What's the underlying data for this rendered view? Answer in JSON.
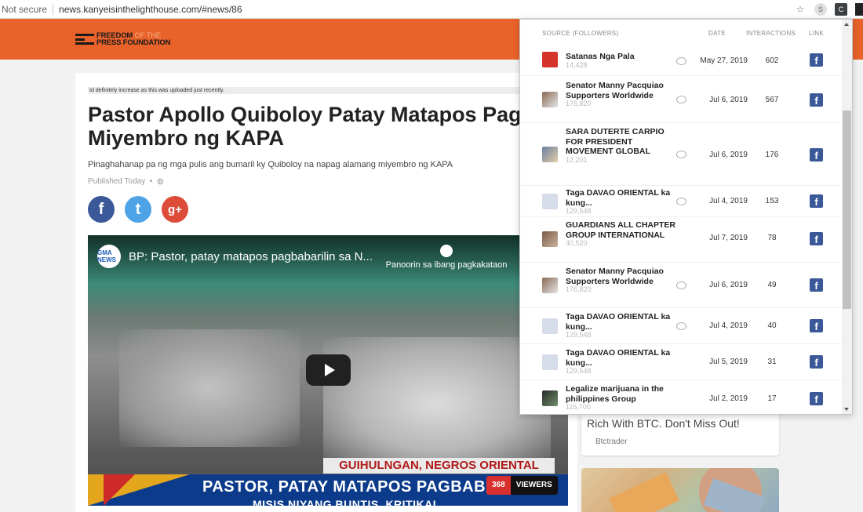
{
  "browser": {
    "security": "Not secure",
    "url": "news.kanyeisinthelighthouse.com/#news/86",
    "icons": [
      "star-icon",
      "skype-extension-icon",
      "extension-icon",
      "extension-icon"
    ]
  },
  "site": {
    "logo_line1_bold": "FREEDOM",
    "logo_line1_light": "OF THE",
    "logo_line2": "PRESS FOUNDATION",
    "accent_color": "#e8622a"
  },
  "article": {
    "note": "Id definitely increase as this was uploaded just recently.",
    "title": "Pastor Apollo Quiboloy Patay Matapos Pag Miyembro ng KAPA",
    "subtitle": "Pinaghahanap pa ng mga pulis ang bumaril ky Quiboloy na napag alamang miyembro ng KAPA",
    "published": "Published Today",
    "published_dot": "•",
    "shares": {
      "facebook": "f",
      "twitter": "t",
      "googleplus": "g+"
    }
  },
  "video": {
    "channel_logo": "GMA NEWS",
    "title": "BP: Pastor, patay matapos pagbabarilin sa N...",
    "watch_later": "Panoorin sa ibang pagkakataon",
    "location": "GUIHULNGAN, NEGROS ORIENTAL",
    "headline": "PASTOR, PATAY MATAPOS PAGBABA",
    "headline2": "MISIS NIYANG BUNTIS, KRITIKAL",
    "viewer_count": "368",
    "viewer_label": "VIEWERS"
  },
  "ad": {
    "headline": "Bitcoin Made “SB's Life”. Trade Bot Rich With BTC. Don't Miss Out!",
    "sponsor": "Btctrader"
  },
  "popup": {
    "headers": {
      "source": "SOURCE (FOLLOWERS)",
      "date": "DATE",
      "interactions": "INTERACTIONS",
      "link": "LINK"
    },
    "rows": [
      {
        "name": "Satanas Nga Pala",
        "followers": "14,428",
        "date": "May 27, 2019",
        "interactions": "602"
      },
      {
        "name": "Senator Manny Pacquiao Supporters Worldwide",
        "followers": "176,820",
        "date": "Jul 6, 2019",
        "interactions": "567"
      },
      {
        "name": "SARA DUTERTE CARPIO FOR PRESIDENT MOVEMENT GLOBAL",
        "followers": "12,201",
        "date": "Jul 6, 2019",
        "interactions": "176"
      },
      {
        "name": "Taga DAVAO ORIENTAL ka kung...",
        "followers": "129,548",
        "date": "Jul 4, 2019",
        "interactions": "153"
      },
      {
        "name": "GUARDIANS ALL CHAPTER GROUP INTERNATIONAL",
        "followers": "40,520",
        "date": "Jul 7, 2019",
        "interactions": "78"
      },
      {
        "name": "Senator Manny Pacquiao Supporters Worldwide",
        "followers": "176,820",
        "date": "Jul 6, 2019",
        "interactions": "49"
      },
      {
        "name": "Taga DAVAO ORIENTAL ka kung...",
        "followers": "129,548",
        "date": "Jul 4, 2019",
        "interactions": "40"
      },
      {
        "name": "Taga DAVAO ORIENTAL ka kung...",
        "followers": "129,548",
        "date": "Jul 5, 2019",
        "interactions": "31"
      },
      {
        "name": "Legalize marijuana in the philippines Group",
        "followers": "115,700",
        "date": "Jul 2, 2019",
        "interactions": "17"
      }
    ]
  }
}
